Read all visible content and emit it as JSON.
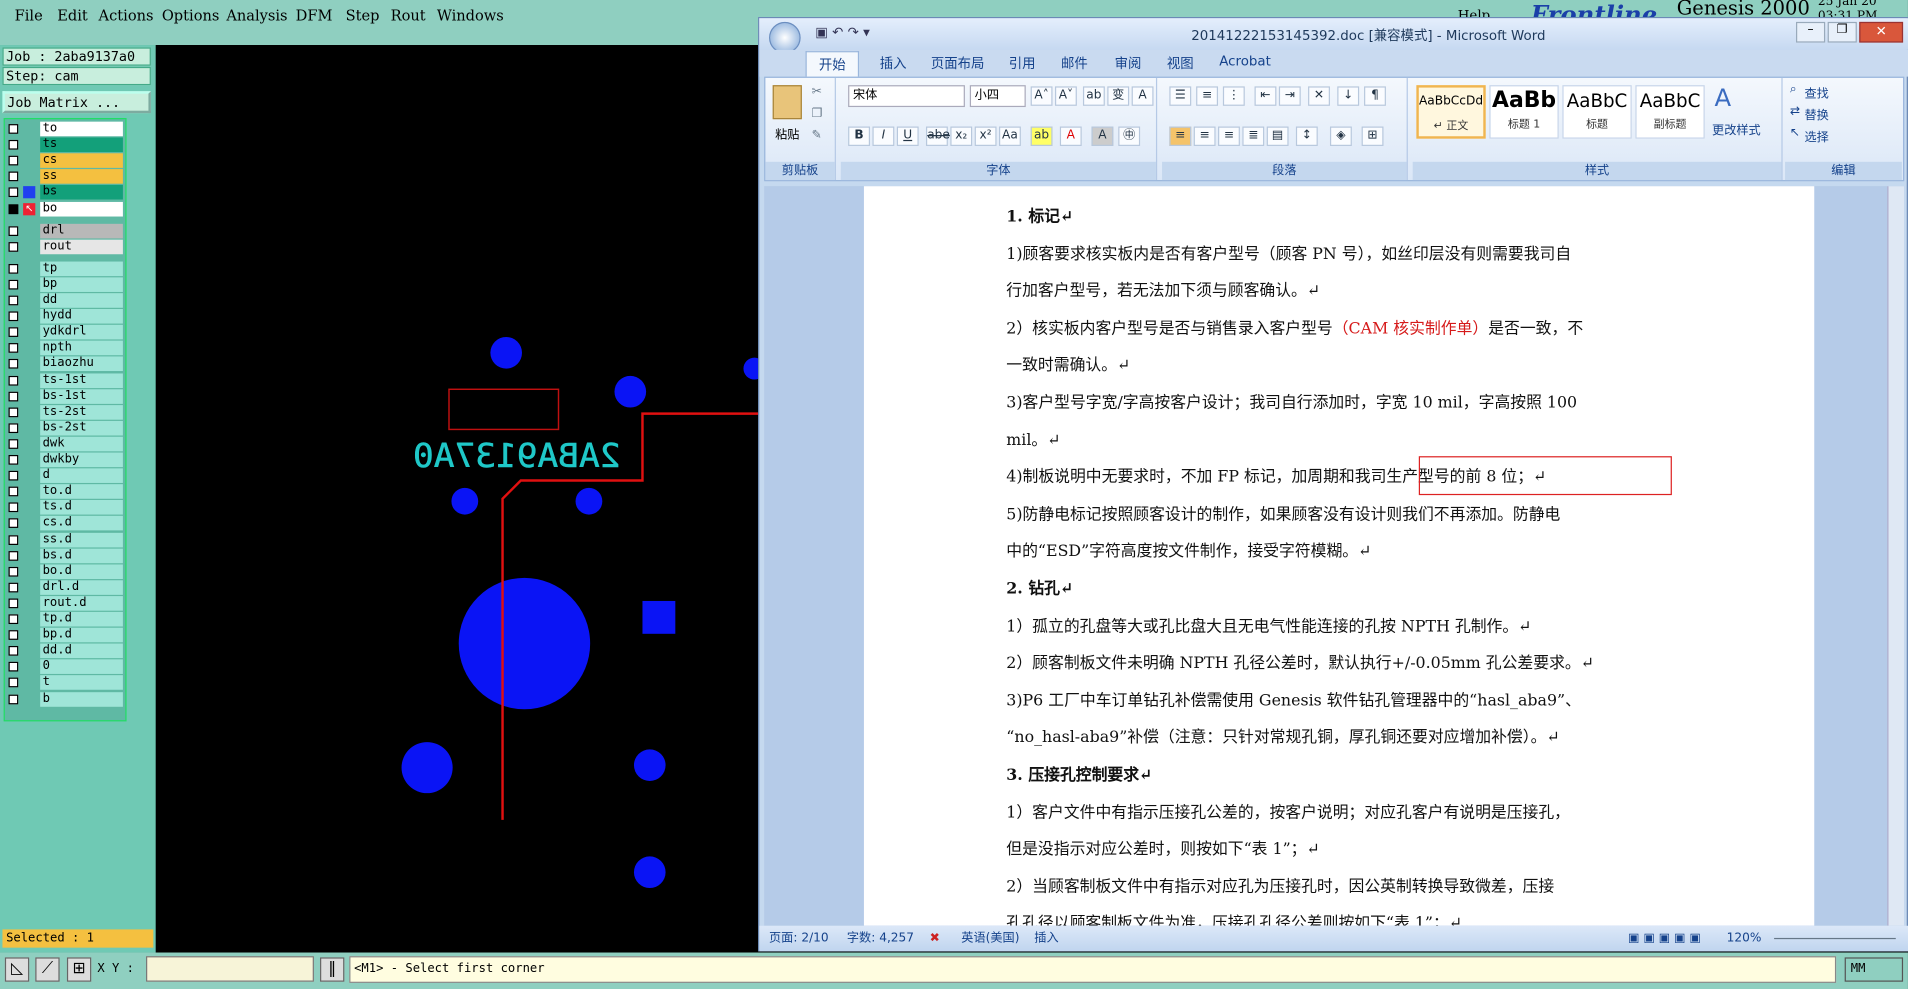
{
  "genesis": {
    "menu": [
      "File",
      "Edit",
      "Actions",
      "Options",
      "Analysis",
      "DFM",
      "Step",
      "Rout",
      "Windows"
    ],
    "help": "Help",
    "brand": "Frontline",
    "product": "Genesis 2000",
    "date": "25 Jan 20",
    "time": "03:31 PM",
    "job_label": "Job : 2aba9137a0",
    "step_label": "Step: cam",
    "job_matrix": "Job Matrix ...",
    "layers": [
      {
        "name": "to",
        "color": "#ffffff",
        "flag": "✎"
      },
      {
        "name": "ts",
        "color": "#13a07a",
        "flag": ""
      },
      {
        "name": "cs",
        "color": "#f4c040",
        "flag": ""
      },
      {
        "name": "ss",
        "color": "#f4c040",
        "flag": ""
      },
      {
        "name": "bs",
        "color": "#13a07a",
        "flag": ""
      },
      {
        "name": "bo",
        "color": "#ffffff",
        "flag": "✎"
      },
      {
        "name": "drl",
        "color": "#b8b8b8",
        "flag": ""
      },
      {
        "name": "rout",
        "color": "#e6e6e6",
        "flag": ""
      },
      {
        "name": "tp",
        "color": "#9fe5d8",
        "flag": ""
      },
      {
        "name": "bp",
        "color": "#9fe5d8",
        "flag": ""
      },
      {
        "name": "dd",
        "color": "#9fe5d8",
        "flag": ""
      },
      {
        "name": "hydd",
        "color": "#9fe5d8",
        "flag": ""
      },
      {
        "name": "ydkdrl",
        "color": "#9fe5d8",
        "flag": ""
      },
      {
        "name": "npth",
        "color": "#9fe5d8",
        "flag": ""
      },
      {
        "name": "biaozhu",
        "color": "#9fe5d8",
        "flag": ""
      },
      {
        "name": "ts-1st",
        "color": "#9fe5d8",
        "flag": ""
      },
      {
        "name": "bs-1st",
        "color": "#9fe5d8",
        "flag": ""
      },
      {
        "name": "ts-2st",
        "color": "#9fe5d8",
        "flag": ""
      },
      {
        "name": "bs-2st",
        "color": "#9fe5d8",
        "flag": ""
      },
      {
        "name": "dwk",
        "color": "#9fe5d8",
        "flag": ""
      },
      {
        "name": "dwkby",
        "color": "#9fe5d8",
        "flag": ""
      },
      {
        "name": "d",
        "color": "#9fe5d8",
        "flag": ""
      },
      {
        "name": "to.d",
        "color": "#9fe5d8",
        "flag": "✎"
      },
      {
        "name": "ts.d",
        "color": "#9fe5d8",
        "flag": ""
      },
      {
        "name": "cs.d",
        "color": "#9fe5d8",
        "flag": ""
      },
      {
        "name": "ss.d",
        "color": "#9fe5d8",
        "flag": ""
      },
      {
        "name": "bs.d",
        "color": "#9fe5d8",
        "flag": ""
      },
      {
        "name": "bo.d",
        "color": "#9fe5d8",
        "flag": "✎"
      },
      {
        "name": "drl.d",
        "color": "#9fe5d8",
        "flag": ""
      },
      {
        "name": "rout.d",
        "color": "#9fe5d8",
        "flag": ""
      },
      {
        "name": "tp.d",
        "color": "#9fe5d8",
        "flag": ""
      },
      {
        "name": "bp.d",
        "color": "#9fe5d8",
        "flag": ""
      },
      {
        "name": "dd.d",
        "color": "#9fe5d8",
        "flag": ""
      },
      {
        "name": "0",
        "color": "#9fe5d8",
        "flag": ""
      },
      {
        "name": "t",
        "color": "#9fe5d8",
        "flag": ""
      },
      {
        "name": "b",
        "color": "#9fe5d8",
        "flag": ""
      }
    ],
    "selected": "Selected : 1",
    "canvas_text": "2ABA9137A0",
    "xy_label": "X Y :",
    "xy_value": "",
    "message": "<M1> - Select first corner",
    "mode": "MM"
  },
  "word": {
    "title": "20141222153145392.doc [兼容模式] - Microsoft Word",
    "tabs": [
      "开始",
      "插入",
      "页面布局",
      "引用",
      "邮件",
      "审阅",
      "视图",
      "Acrobat"
    ],
    "clipboard": {
      "paste": "粘贴",
      "group": "剪贴板"
    },
    "font": {
      "name": "宋体",
      "size": "小四",
      "group": "字体"
    },
    "paragraph_group": "段落",
    "styles": [
      {
        "preview": "AaBbCcDd",
        "name": "↵ 正文"
      },
      {
        "preview": "AaBb",
        "name": "标题 1"
      },
      {
        "preview": "AaBbC",
        "name": "标题"
      },
      {
        "preview": "AaBbC",
        "name": "副标题"
      }
    ],
    "change_styles": "更改样式",
    "styles_group": "样式",
    "editing": {
      "find": "查找",
      "replace": "替换",
      "select": "选择",
      "group": "编辑"
    },
    "document_lines": [
      {
        "text": "1. 标记↵",
        "heading": true
      },
      {
        "text": "1)顾客要求核实板内是否有客户型号（顾客 PN 号），如丝印层没有则需要我司自",
        "heading": false
      },
      {
        "text": "行加客户型号，若无法加下须与顾客确认。↵",
        "heading": false
      },
      {
        "text": "2）核实板内客户型号是否与销售录入客户型号",
        "red": "（CAM 核实制作单）",
        "after": "是否一致，不",
        "heading": false
      },
      {
        "text": "一致时需确认。↵",
        "heading": false
      },
      {
        "text": "3)客户型号字宽/字高按客户设计；我司自行添加时，字宽 10 mil，字高按照 100",
        "heading": false
      },
      {
        "text": "mil。↵",
        "heading": false
      },
      {
        "text": "4)制板说明中无要求时，不加 FP 标记，加周期和我司生产型号的前 8 位；↵",
        "heading": false
      },
      {
        "text": "5)防静电标记按照顾客设计的制作，如果顾客没有设计则我们不再添加。防静电",
        "heading": false
      },
      {
        "text": "中的“ESD”字符高度按文件制作，接受字符模糊。↵",
        "heading": false
      },
      {
        "text": "2. 钻孔↵",
        "heading": true
      },
      {
        "text": "1）孤立的孔盘等大或孔比盘大且无电气性能连接的孔按 NPTH 孔制作。↵",
        "heading": false
      },
      {
        "text": "2）顾客制板文件未明确 NPTH 孔径公差时，默认执行+/-0.05mm 孔公差要求。↵",
        "heading": false
      },
      {
        "text": "3)P6 工厂中车订单钻孔补偿需使用 Genesis 软件钻孔管理器中的“hasl_aba9”、",
        "heading": false
      },
      {
        "text": "“no_hasl-aba9”补偿（注意：只针对常规孔铜，厚孔铜还要对应增加补偿）。↵",
        "heading": false
      },
      {
        "text": "3. 压接孔控制要求↵",
        "heading": true
      },
      {
        "text": "1）客户文件中有指示压接孔公差的，按客户说明；对应孔客户有说明是压接孔，",
        "heading": false
      },
      {
        "text": "但是没指示对应公差时，则按如下“表 1”；↵",
        "heading": false
      },
      {
        "text": "2）当顾客制板文件中有指示对应孔为压接孔时，因公英制转换导致微差，压接",
        "heading": false
      },
      {
        "text": "孔孔径以顾客制板文件为准，压接孔孔径公差则按如下“表 1”；↵",
        "heading": false
      }
    ],
    "status": {
      "page": "页面: 2/10",
      "words": "字数: 4,257",
      "lang": "英语(美国)",
      "mode": "插入",
      "zoom": "120%"
    }
  }
}
